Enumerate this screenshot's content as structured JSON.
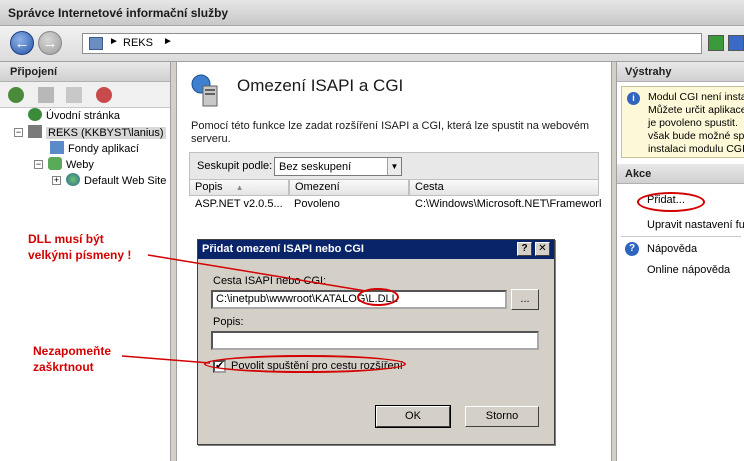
{
  "window": {
    "title": "Správce Internetové informační služby"
  },
  "address": {
    "node": "REKS"
  },
  "connections": {
    "title": "Připojení",
    "tree": [
      {
        "label": "Úvodní stránka"
      },
      {
        "label": "REKS (KKBYST\\lanius)"
      },
      {
        "label": "Fondy aplikací"
      },
      {
        "label": "Weby"
      },
      {
        "label": "Default Web Site"
      }
    ]
  },
  "feature": {
    "title": "Omezení ISAPI a CGI",
    "description": "Pomocí této funkce lze zadat rozšíření ISAPI a CGI, která lze spustit na webovém serveru.",
    "group_label": "Seskupit podle:",
    "group_value": "Bez seskupení",
    "columns": [
      "Popis",
      "Omezení",
      "Cesta"
    ],
    "rows": [
      {
        "popis": "ASP.NET v2.0.5...",
        "omezeni": "Povoleno",
        "cesta": "C:\\Windows\\Microsoft.NET\\Framework"
      }
    ]
  },
  "alerts": {
    "title": "Výstrahy",
    "lines": [
      "Modul CGI není insta",
      "Můžete určit aplikace",
      "je povoleno spustit.",
      "však bude možné spus",
      "instalaci modulu CGI"
    ]
  },
  "actions": {
    "title": "Akce",
    "add": "Přidat...",
    "edit": "Upravit nastavení fu",
    "help": "Nápověda",
    "online_help": "Online nápověda"
  },
  "dialog": {
    "title": "Přidat omezení ISAPI nebo CGI",
    "path_label": "Cesta ISAPI nebo CGI:",
    "path_value": "C:\\inetpub\\wwwroot\\KATALOG\\L.DLL",
    "browse_label": "...",
    "desc_label": "Popis:",
    "desc_value": "",
    "checkbox_label": "Povolit spuštění pro cestu rozšíření",
    "checkbox_checked": true,
    "ok": "OK",
    "cancel": "Storno",
    "help_btn": "?",
    "close_btn": "✕"
  },
  "annotations": {
    "dll_note_line1": "DLL musí být",
    "dll_note_line2": "velkými písmeny !",
    "check_note_line1": "Nezapomeňte",
    "check_note_line2": "zaškrtnout",
    "color": "#d40000"
  }
}
